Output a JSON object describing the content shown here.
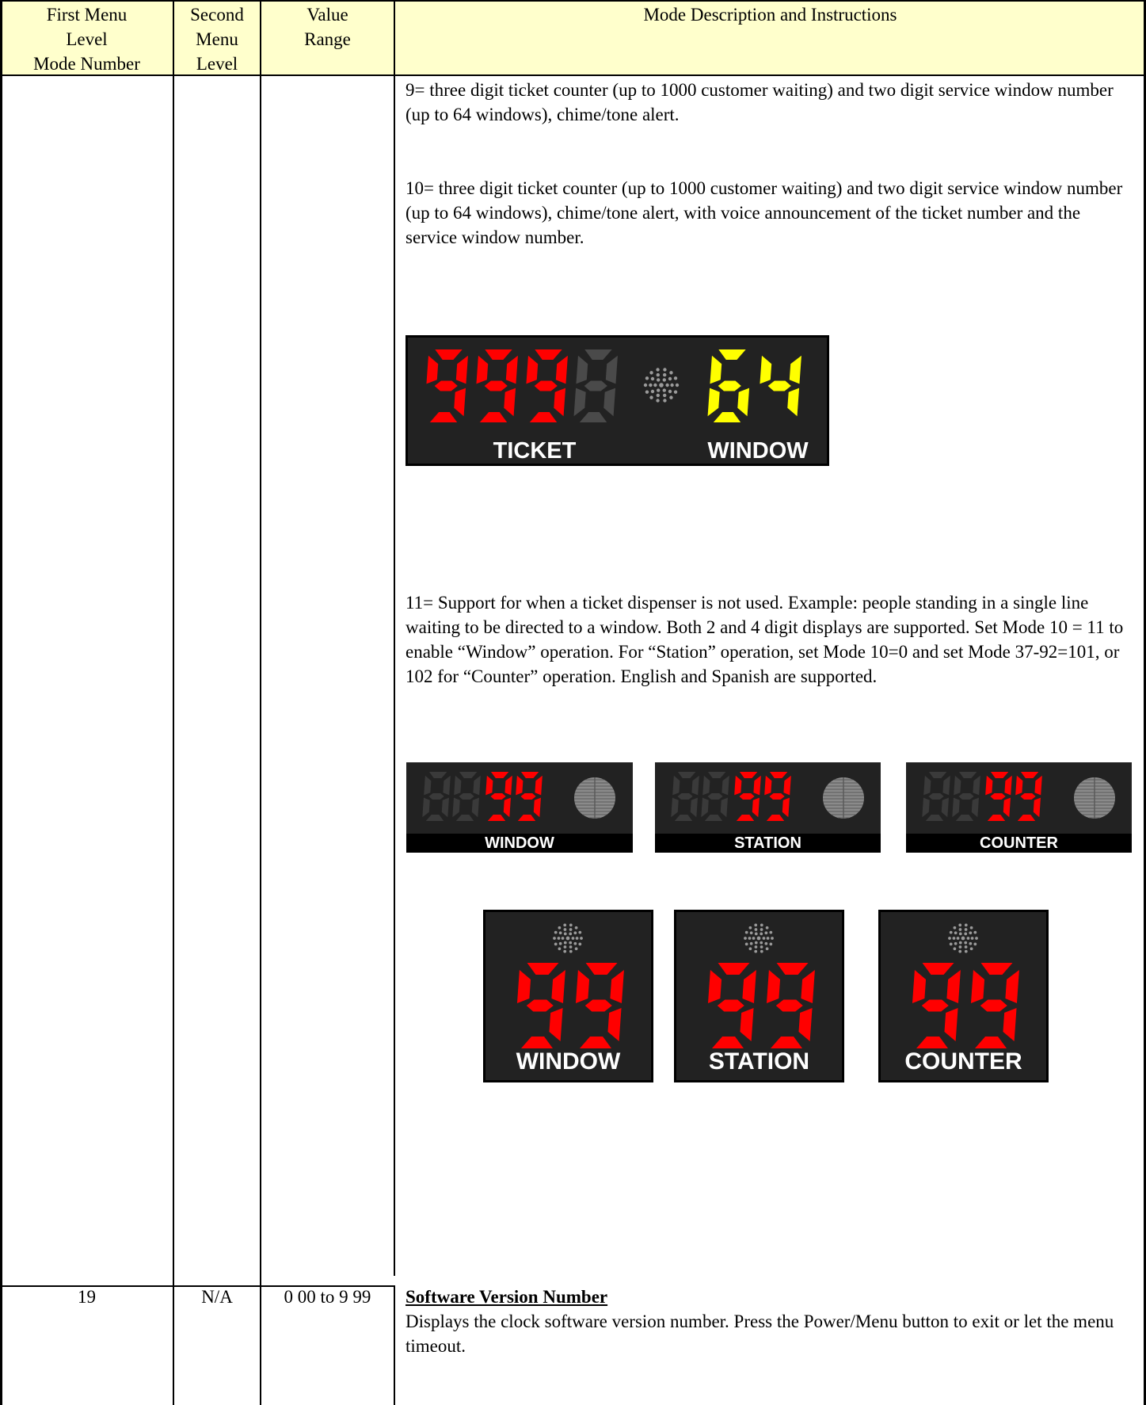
{
  "header": {
    "col1": [
      "First Menu",
      "Level",
      "Mode Number"
    ],
    "col2": [
      "Second",
      "Menu",
      "Level"
    ],
    "col3": [
      "Value",
      "Range"
    ],
    "col4": "Mode Description and Instructions"
  },
  "modes": {
    "m9": "9= three digit ticket counter (up to 1000 customer waiting) and  two digit service window number (up to 64 windows), chime/tone alert.",
    "m10": "10= three digit ticket counter (up to 1000 customer waiting) and  two digit service window number (up to 64 windows), chime/tone alert, with voice announcement of the ticket number and the service window number.",
    "m11": "11= Support for when a ticket dispenser is not used. Example: people standing in a single line waiting to be directed to a window. Both 2 and 4 digit displays are supported.  Set Mode 10 = 11 to enable “Window” operation.  For “Station” operation, set Mode 10=0 and set Mode 37-92=101, or 102 for “Counter” operation.  English and Spanish are supported."
  },
  "ticket_display": {
    "ticket_digits": "999",
    "window_digits": "64",
    "ticket_label": "TICKET",
    "window_label": "WINDOW",
    "colors": {
      "ticket": "#ff0000",
      "window": "#ffff00",
      "unlit": "#4a4a4a",
      "background": "#222222"
    }
  },
  "wide_displays": [
    {
      "value": "99",
      "label": "WINDOW"
    },
    {
      "value": "99",
      "label": "STATION"
    },
    {
      "value": "99",
      "label": "COUNTER"
    }
  ],
  "square_displays": [
    {
      "value": "99",
      "label": "WINDOW"
    },
    {
      "value": "99",
      "label": "STATION"
    },
    {
      "value": "99",
      "label": "COUNTER"
    }
  ],
  "row19": {
    "mode": "19",
    "second": "N/A",
    "range": "0 00 to 9 99",
    "title": "Software Version Number",
    "desc": "Displays the clock software version number.  Press the Power/Menu button to exit or let the menu timeout."
  }
}
